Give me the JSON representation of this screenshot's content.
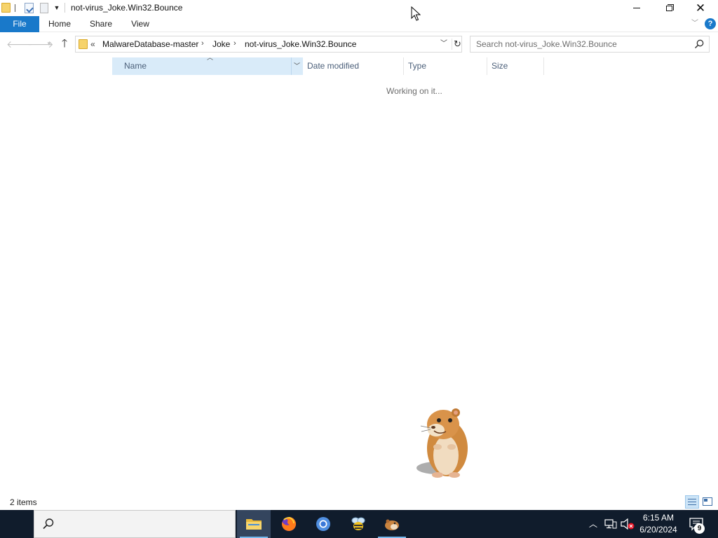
{
  "window": {
    "title": "not-virus_Joke.Win32.Bounce",
    "controls": {
      "minimize": "minimize",
      "maximize": "restore",
      "close": "close"
    }
  },
  "ribbon": {
    "tabs": [
      {
        "label": "File"
      },
      {
        "label": "Home"
      },
      {
        "label": "Share"
      },
      {
        "label": "View"
      }
    ],
    "help": "?"
  },
  "nav": {
    "overflow": "«",
    "breadcrumbs": [
      "MalwareDatabase-master",
      "Joke",
      "not-virus_Joke.Win32.Bounce"
    ],
    "separator": "›"
  },
  "search": {
    "placeholder": "Search not-virus_Joke.Win32.Bounce"
  },
  "columns": {
    "name": "Name",
    "date_modified": "Date modified",
    "type": "Type",
    "size": "Size"
  },
  "content": {
    "status": "Working on it..."
  },
  "statusbar": {
    "item_count": "2 items"
  },
  "taskbar": {
    "apps": [
      {
        "name": "File Explorer",
        "icon": "folder-icon",
        "active": true
      },
      {
        "name": "Firefox",
        "icon": "firefox-icon"
      },
      {
        "name": "Chrome",
        "icon": "chrome-icon"
      },
      {
        "name": "Bee app",
        "icon": "bee-icon"
      },
      {
        "name": "Bounce hamster",
        "icon": "hamster-icon",
        "running": true
      }
    ],
    "clock": {
      "time": "6:15 AM",
      "date": "6/20/2024"
    },
    "notification_count": "9",
    "tray_icons": [
      "chevron-up-icon",
      "network-icon",
      "volume-muted-icon"
    ]
  },
  "colors": {
    "accent": "#1979ca",
    "taskbar": "#101c2c",
    "selected_column": "#d9ebf9"
  }
}
